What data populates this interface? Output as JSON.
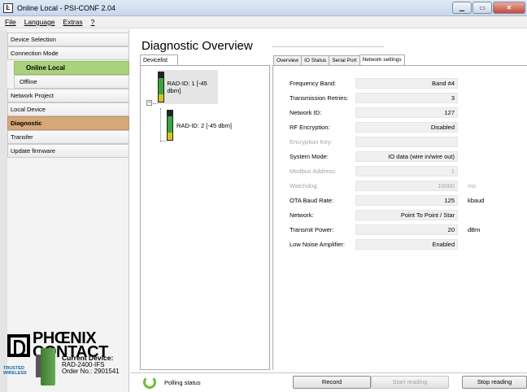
{
  "window": {
    "title": "Online Local - PSI-CONF 2.04",
    "app_icon": "phoenix-logo-icon"
  },
  "menu": [
    "File",
    "Language",
    "Extras",
    "?"
  ],
  "sidebar": {
    "items": [
      {
        "label": "Device Selection"
      },
      {
        "label": "Connection Mode"
      },
      {
        "label": "Online Local"
      },
      {
        "label": "Offline"
      },
      {
        "label": "Network Project"
      },
      {
        "label": "Local Device"
      },
      {
        "label": "Diagnostic"
      },
      {
        "label": "Transfer"
      },
      {
        "label": "Update firmware"
      }
    ],
    "logo_line1": "PHŒNIX",
    "logo_line2": "CONTACT",
    "trusted_line1": "TRUSTED",
    "trusted_line2": "WIRELESS",
    "current_device_title": "Current Device:",
    "current_device_model": "RAD-2400-IFS",
    "current_device_order": "Order No.: 2901541"
  },
  "main": {
    "title": "Diagnostic Overview",
    "devicelist_tab": "Devicelist",
    "tree": {
      "expander": "⊟",
      "node1": "RAD-ID: 1 [-45 dbm]",
      "node2": "RAD-ID: 2 [-45 dbm]"
    },
    "tabs": [
      "Overview",
      "IO Status",
      "Serial Port",
      "Network settings"
    ],
    "active_tab": "Network settings",
    "fields": [
      {
        "label": "Frequency Band:",
        "value": "Band #4",
        "unit": "",
        "disabled": false
      },
      {
        "label": "Transmission Retries:",
        "value": "3",
        "unit": "",
        "disabled": false
      },
      {
        "label": "Network ID:",
        "value": "127",
        "unit": "",
        "disabled": false
      },
      {
        "label": "RF Encryption:",
        "value": "Disabled",
        "unit": "",
        "disabled": false
      },
      {
        "label": "Encryption Key:",
        "value": "",
        "unit": "",
        "disabled": true
      },
      {
        "label": "System Mode:",
        "value": "IO data (wire in/wire out)",
        "unit": "",
        "disabled": false
      },
      {
        "label": "Modbus Address:",
        "value": "1",
        "unit": "",
        "disabled": true
      },
      {
        "label": "Watchdog:",
        "value": "10000",
        "unit": "ms",
        "disabled": true
      },
      {
        "label": "OTA Baud Rate:",
        "value": "125",
        "unit": "kbaud",
        "disabled": false
      },
      {
        "label": "Network:",
        "value": "Point To Point / Star",
        "unit": "",
        "disabled": false
      },
      {
        "label": "Transmit Power:",
        "value": "20",
        "unit": "dBm",
        "disabled": false
      },
      {
        "label": "Low Noise Amplifier:",
        "value": "Enabled",
        "unit": "",
        "disabled": false
      }
    ]
  },
  "status": {
    "polling": "Polling status",
    "record": "Record",
    "start_reading": "Start reading",
    "stop_reading": "Stop reading"
  }
}
